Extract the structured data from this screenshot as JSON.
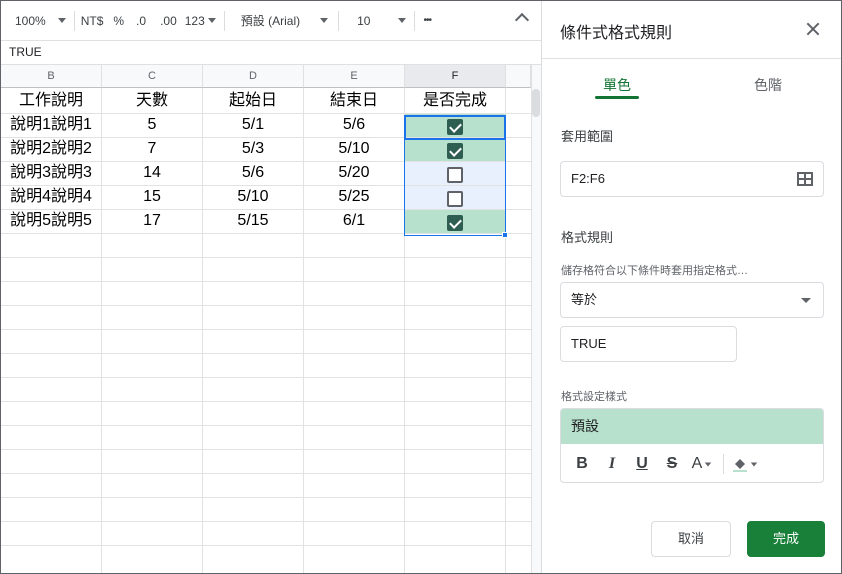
{
  "toolbar": {
    "zoom": "100%",
    "currency": "NT$",
    "percent": "%",
    "dec_decrease": ".0",
    "dec_increase": ".00",
    "more_formats": "123",
    "font": "預設 (Arial)",
    "font_size": "10",
    "more": "•••"
  },
  "formula_bar": {
    "value": "TRUE"
  },
  "columns": [
    "B",
    "C",
    "D",
    "E",
    "F"
  ],
  "header_row": [
    "工作說明",
    "天數",
    "起始日",
    "結束日",
    "是否完成"
  ],
  "rows": [
    {
      "desc": "說明1說明1",
      "days": "5",
      "start": "5/1",
      "end": "5/6",
      "done": true
    },
    {
      "desc": "說明2說明2",
      "days": "7",
      "start": "5/3",
      "end": "5/10",
      "done": true
    },
    {
      "desc": "說明3說明3",
      "days": "14",
      "start": "5/6",
      "end": "5/20",
      "done": false
    },
    {
      "desc": "說明4說明4",
      "days": "15",
      "start": "5/10",
      "end": "5/25",
      "done": false
    },
    {
      "desc": "說明5說明5",
      "days": "17",
      "start": "5/15",
      "end": "6/1",
      "done": true
    }
  ],
  "panel": {
    "title": "條件式格式規則",
    "tabs": [
      "單色",
      "色階"
    ],
    "range_label": "套用範圍",
    "range_value": "F2:F6",
    "rules_label": "格式規則",
    "condition_hint": "儲存格符合以下條件時套用指定格式…",
    "condition": "等於",
    "value": "TRUE",
    "style_label": "格式設定樣式",
    "style_preview": "預設",
    "format_buttons": [
      "B",
      "I",
      "U",
      "S",
      "A"
    ],
    "cancel": "取消",
    "done": "完成"
  },
  "colors": {
    "accent_green": "#137333",
    "done_button": "#188038",
    "fill_true": "#b7e1cd",
    "fill_false": "#e8f0fe",
    "selection": "#1a73e8"
  }
}
